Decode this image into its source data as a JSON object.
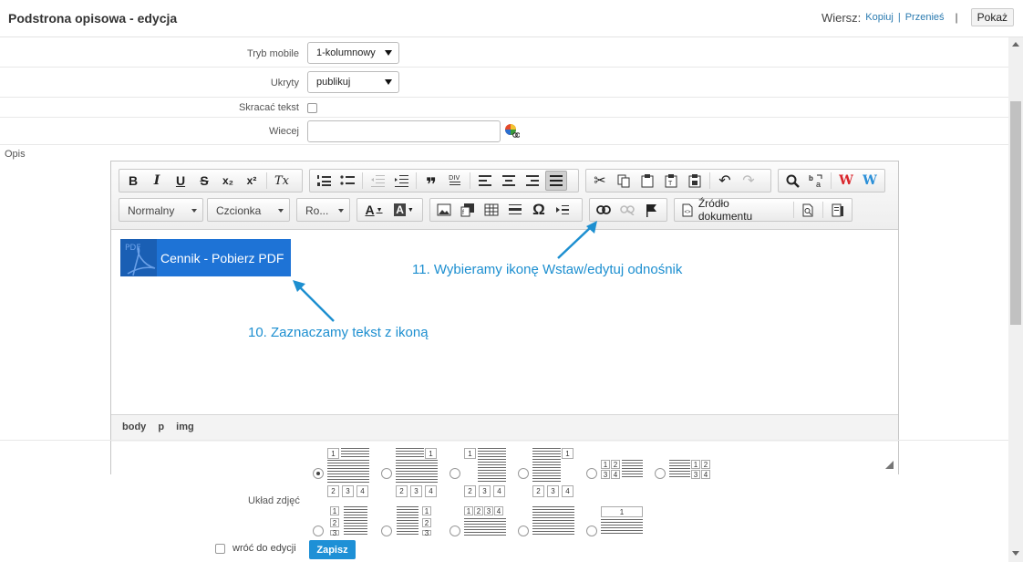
{
  "header": {
    "title": "Podstrona opisowa - edycja",
    "row_label": "Wiersz:",
    "copy_link": "Kopiuj",
    "link_sep": "|",
    "move_link": "Przenieś",
    "sep": "|",
    "show_button": "Pokaż"
  },
  "form": {
    "mobile_mode": {
      "label": "Tryb mobile",
      "value": "1-kolumnowy"
    },
    "hidden": {
      "label": "Ukryty",
      "value": "publikuj"
    },
    "shorten_text": {
      "label": "Skracać tekst",
      "checked": false
    },
    "more": {
      "label": "Wiecej",
      "value": ""
    },
    "description_label": "Opis",
    "photo_layout_label": "Układ zdjęć"
  },
  "editor": {
    "toolbar": {
      "format_combo": "Normalny",
      "font_combo": "Czcionka",
      "size_combo": "Ro...",
      "text_color": "A",
      "bg_color": "A",
      "source_button": "Źródło dokumentu",
      "bold": "B",
      "italic": "I",
      "underline": "U",
      "strike": "S",
      "subscript": "x₂",
      "superscript": "x²",
      "remove_format": "Tx",
      "blockquote": "❞",
      "special_char": "Ω",
      "word_red": "W",
      "word_blue": "W"
    },
    "content": {
      "selected_text": "Cennik - Pobierz PDF",
      "pdf_icon_label": "PDF"
    },
    "path": [
      "body",
      "p",
      "img"
    ]
  },
  "annotations": {
    "step10": "10. Zaznaczamy tekst z ikoną",
    "step11": "11. Wybieramy ikonę Wstaw/edytuj odnośnik"
  },
  "layout_thumbs": {
    "nums": {
      "one": "1",
      "two": "2",
      "three": "3",
      "four": "4"
    }
  },
  "footer": {
    "back_to_edit": "wróć do edycji",
    "save_button": "Zapisz"
  },
  "colors": {
    "accent": "#1e90d6",
    "selection": "#1e73d6",
    "annotation": "#1d8fd0",
    "word_red": "#d9262c",
    "word_blue": "#2a8fd8"
  },
  "icons": [
    "cut-icon",
    "copy-icon",
    "paste-icon",
    "link-icon",
    "unlink-icon",
    "anchor-flag-icon",
    "search-icon",
    "replace-icon",
    "undo-icon",
    "redo-icon",
    "image-icon",
    "table-icon",
    "color-picker-icon",
    "pdf-icon"
  ]
}
